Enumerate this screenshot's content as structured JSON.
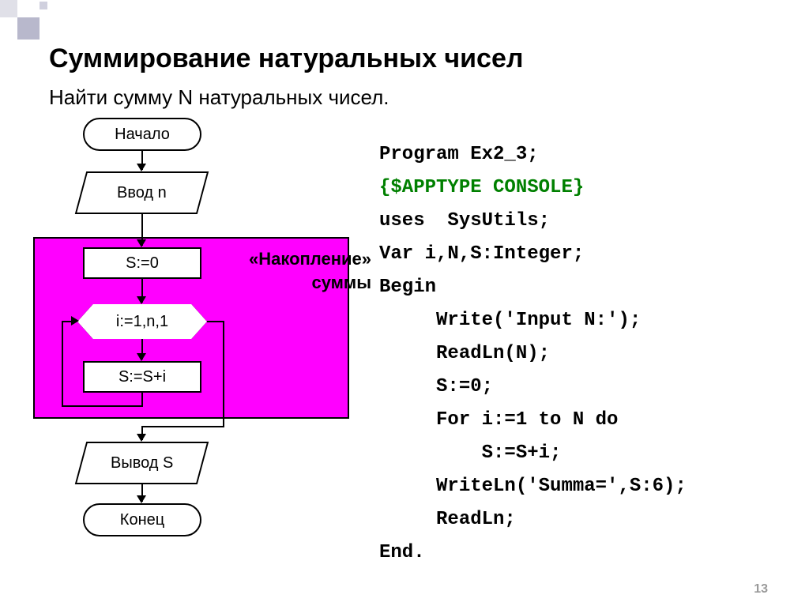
{
  "title": "Суммирование натуральных чисел",
  "subtitle": "Найти сумму N натуральных чисел.",
  "flow": {
    "start": "Начало",
    "input": "Ввод\nn",
    "init": "S:=0",
    "accum_label": "«Накопление»\nсуммы",
    "loop": "i:=1,n,1",
    "body": "S:=S+i",
    "output": "Вывод\nS",
    "end": "Конец"
  },
  "code": {
    "l1": "Program Ex2_3;",
    "l2": "{$APPTYPE CONSOLE}",
    "l3": "uses  SysUtils;",
    "l4": "Var i,N,S:Integer;",
    "l5": "Begin",
    "l6": "     Write('Input N:');",
    "l7": "     ReadLn(N);",
    "l8": "     S:=0;",
    "l9": "     For i:=1 to N do",
    "l10": "         S:=S+i;",
    "l11": "     WriteLn('Summa=',S:6);",
    "l12": "     ReadLn;",
    "l13": "End."
  },
  "page_number": "13"
}
